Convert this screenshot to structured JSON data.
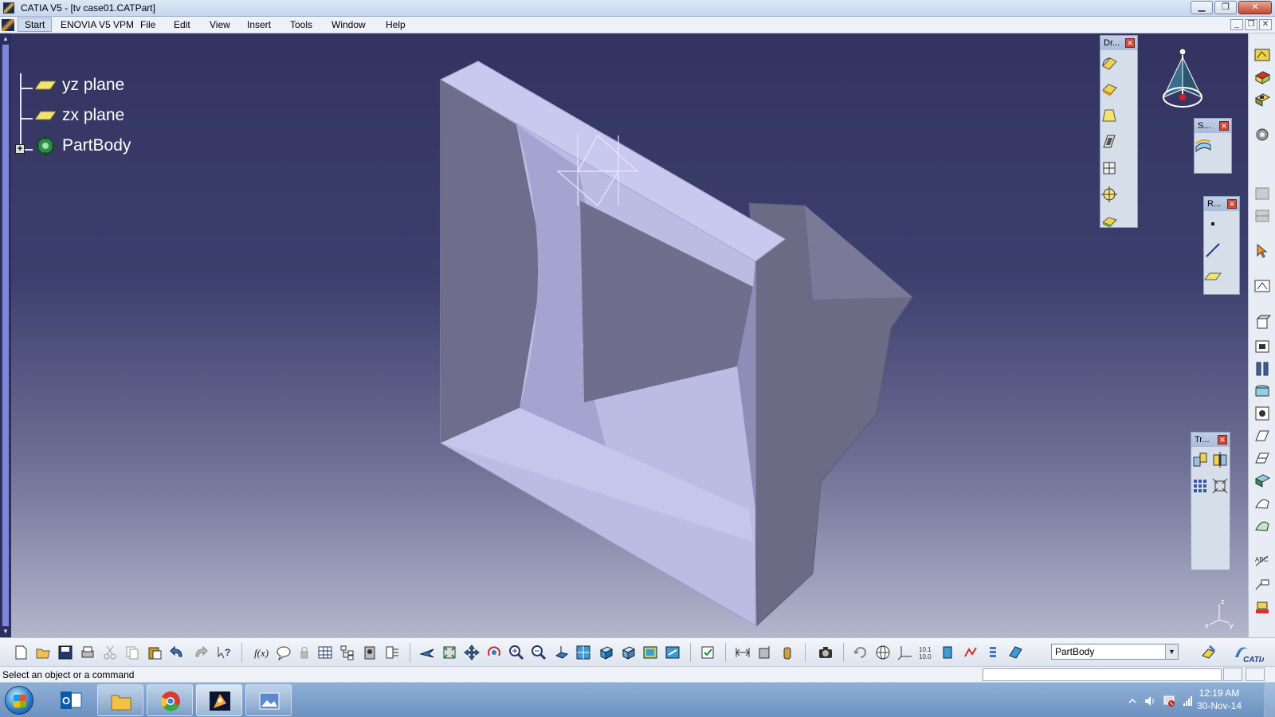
{
  "window": {
    "title": "CATIA V5 - [tv case01.CATPart]",
    "min_label": "▁",
    "max_label": "❐",
    "close_label": "✕"
  },
  "menu": {
    "items": [
      "Start",
      "ENOVIA V5 VPM",
      "File",
      "Edit",
      "View",
      "Insert",
      "Tools",
      "Window",
      "Help"
    ]
  },
  "tree": {
    "items": [
      {
        "label": "yz plane",
        "icon": "plane-icon"
      },
      {
        "label": "zx plane",
        "icon": "plane-icon"
      },
      {
        "label": "PartBody",
        "icon": "partbody-icon"
      }
    ]
  },
  "floating_toolbars": {
    "dress_up": {
      "title": "Dr..."
    },
    "surface": {
      "title": "S..."
    },
    "reference": {
      "title": "R..."
    },
    "transform": {
      "title": "Tr..."
    }
  },
  "compass_axes": {
    "z": "z",
    "x": "x",
    "y": "y"
  },
  "body_selector": {
    "value": "PartBody"
  },
  "status": {
    "text": "Select an object or a command"
  },
  "taskbar": {
    "time": "12:19 AM",
    "date": "30-Nov-14"
  },
  "colors": {
    "viewport_top": "#333361",
    "viewport_bottom": "#b4b6cd",
    "part_face": "#bab9e2",
    "part_side": "#6b6b86"
  }
}
